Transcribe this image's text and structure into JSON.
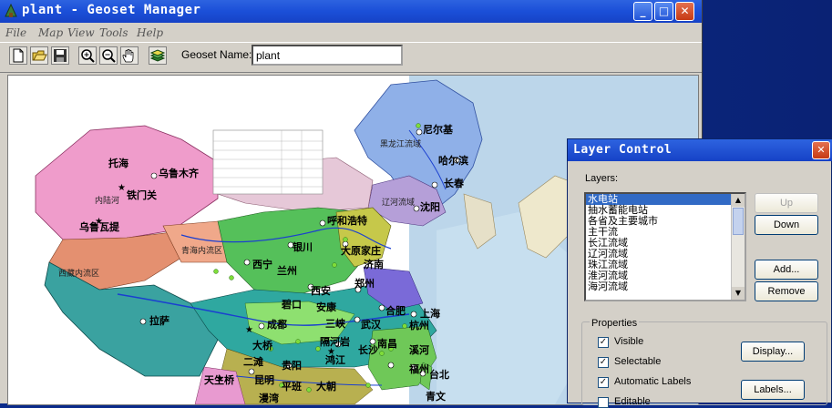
{
  "window": {
    "title": "plant - Geoset Manager",
    "controls": {
      "minimize": "_",
      "maximize": "□",
      "close": "✕"
    }
  },
  "menu": [
    "File",
    "Map",
    "View",
    "Tools",
    "Help"
  ],
  "toolbar": {
    "tools": [
      "new-icon",
      "open-icon",
      "save-icon",
      "zoom-in-icon",
      "zoom-out-icon",
      "pan-hand-icon",
      "layers-icon"
    ],
    "geoset_label": "Geoset Name:",
    "geoset_value": "plant"
  },
  "map": {
    "cities": [
      {
        "name": "尼尔基"
      },
      {
        "name": "哈尔滨"
      },
      {
        "name": "长春"
      },
      {
        "name": "沈阳"
      },
      {
        "name": "乌鲁木齐"
      },
      {
        "name": "铁门关"
      },
      {
        "name": "乌鲁瓦提"
      },
      {
        "name": "托海"
      },
      {
        "name": "呼和浩特"
      },
      {
        "name": "大原家庄"
      },
      {
        "name": "银川"
      },
      {
        "name": "西宁"
      },
      {
        "name": "兰州"
      },
      {
        "name": "济南"
      },
      {
        "name": "西安"
      },
      {
        "name": "郑州"
      },
      {
        "name": "拉萨"
      },
      {
        "name": "碧口"
      },
      {
        "name": "安康"
      },
      {
        "name": "合肥"
      },
      {
        "name": "上海"
      },
      {
        "name": "杭州"
      },
      {
        "name": "成都"
      },
      {
        "name": "三峡"
      },
      {
        "name": "武汉"
      },
      {
        "name": "大桥"
      },
      {
        "name": "长沙"
      },
      {
        "name": "南昌"
      },
      {
        "name": "二滩"
      },
      {
        "name": "贵阳"
      },
      {
        "name": "隔河岩"
      },
      {
        "name": "鸿江"
      },
      {
        "name": "福州"
      },
      {
        "name": "台北"
      },
      {
        "name": "昆明"
      },
      {
        "name": "大朝"
      },
      {
        "name": "平班"
      },
      {
        "name": "青文"
      },
      {
        "name": "漫湾"
      },
      {
        "name": "天生桥"
      },
      {
        "name": "溪河"
      },
      {
        "name": "西藏内流区"
      },
      {
        "name": "青海内流区"
      },
      {
        "name": "内陆河"
      }
    ],
    "region_labels": [
      "黑龙江流域",
      "辽河流域"
    ]
  },
  "layer_control": {
    "title": "Layer Control",
    "layers_label": "Layers:",
    "layers": [
      "水电站",
      "抽水蓄能电站",
      "各省及主要城市",
      "主干流",
      "长江流域",
      "辽河流域",
      "珠江流域",
      "淮河流域",
      "海河流域"
    ],
    "selected_index": 0,
    "buttons": {
      "up": "Up",
      "down": "Down",
      "add": "Add...",
      "remove": "Remove",
      "display": "Display...",
      "labels": "Labels..."
    },
    "properties_label": "Properties",
    "properties": [
      {
        "label": "Visible",
        "checked": true
      },
      {
        "label": "Selectable",
        "checked": true
      },
      {
        "label": "Automatic Labels",
        "checked": true
      },
      {
        "label": "Editable",
        "checked": false
      }
    ]
  },
  "colors": {
    "titlebar": "#1b4fd8",
    "selection": "#316ac5",
    "face": "#d4d0c8"
  }
}
